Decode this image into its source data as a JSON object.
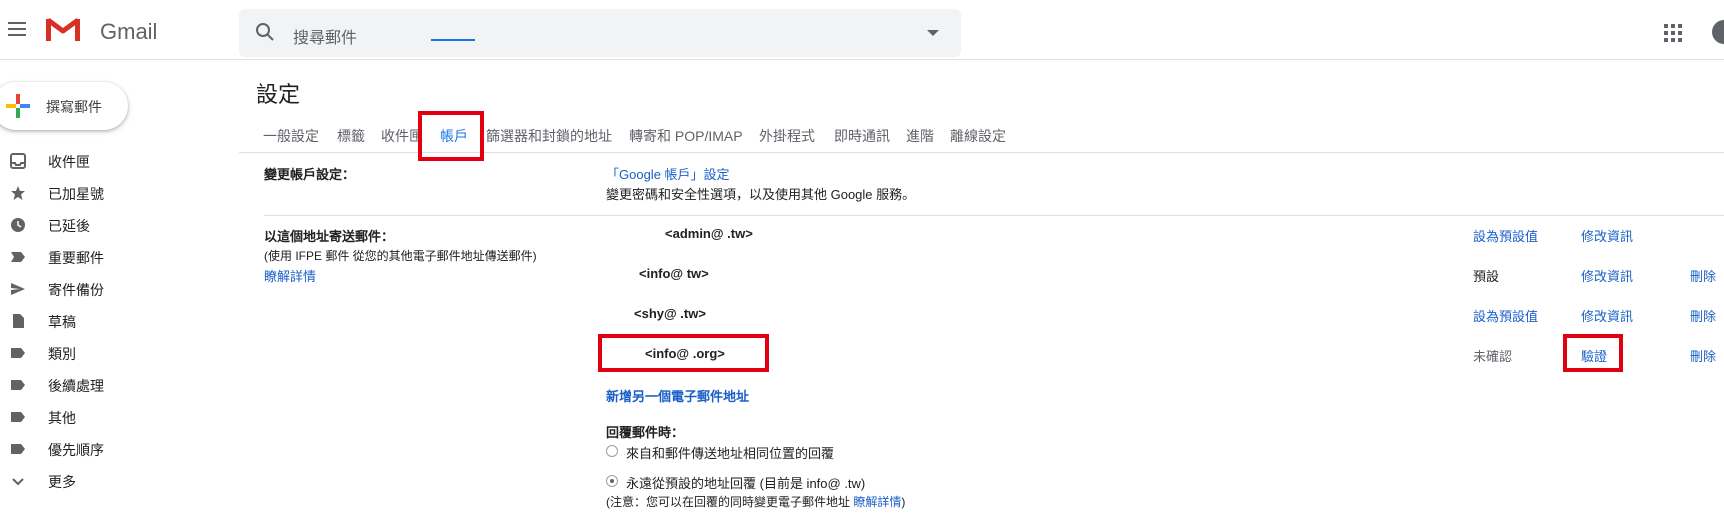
{
  "app": {
    "name": "Gmail"
  },
  "search": {
    "placeholder": "搜尋郵件"
  },
  "compose": {
    "label": "撰寫郵件"
  },
  "sidebar": {
    "items": [
      {
        "label": "收件匣",
        "icon": "inbox-icon"
      },
      {
        "label": "已加星號",
        "icon": "star-icon"
      },
      {
        "label": "已延後",
        "icon": "clock-icon"
      },
      {
        "label": "重要郵件",
        "icon": "important-icon"
      },
      {
        "label": "寄件備份",
        "icon": "send-icon"
      },
      {
        "label": "草稿",
        "icon": "draft-icon"
      },
      {
        "label": "類別",
        "icon": "label-icon"
      },
      {
        "label": "後續處理",
        "icon": "label-icon"
      },
      {
        "label": "其他",
        "icon": "label-icon"
      },
      {
        "label": "優先順序",
        "icon": "label-icon"
      },
      {
        "label": "更多",
        "icon": "chevron-down-icon"
      }
    ]
  },
  "settings": {
    "title": "設定",
    "tabs": [
      "一般設定",
      "標籤",
      "收件匣",
      "帳戶",
      "篩選器和封鎖的地址",
      "轉寄和 POP/IMAP",
      "外掛程式",
      "即時通訊",
      "進階",
      "離線設定"
    ],
    "active_tab": "帳戶"
  },
  "change_account": {
    "label": "變更帳戶設定：",
    "link": "「Google 帳戶」設定",
    "desc": "變更密碼和安全性選項，以及使用其他 Google 服務。"
  },
  "send_as": {
    "label": "以這個地址寄送郵件：",
    "note": "(使用 IFPE 郵件 從您的其他電子郵件地址傳送郵件)",
    "learn_more": "瞭解詳情",
    "addresses": [
      {
        "address": "<admin@      .tw>",
        "status": "設為預設值",
        "edit": "修改資訊",
        "delete": ""
      },
      {
        "address": "<info@       tw>",
        "status": "預設",
        "edit": "修改資訊",
        "delete": "刪除"
      },
      {
        "address": "<shy@      .tw>",
        "status": "設為預設值",
        "edit": "修改資訊",
        "delete": "刪除"
      },
      {
        "address": "<info@        .org>",
        "status": "未確認",
        "edit": "驗證",
        "delete": "刪除"
      }
    ],
    "add_another": "新增另一個電子郵件地址"
  },
  "reply": {
    "label": "回覆郵件時：",
    "option1": "來自和郵件傳送地址相同位置的回覆",
    "option2": "永遠從預設的地址回覆 (目前是 info@       .tw)",
    "note": "(注意：您可以在回覆的同時變更電子郵件地址",
    "note_link": "瞭解詳情",
    "note_end": ")"
  },
  "colors": {
    "accent": "#1a73e8",
    "link": "#1a5fc8",
    "highlight": "#e0000f"
  }
}
